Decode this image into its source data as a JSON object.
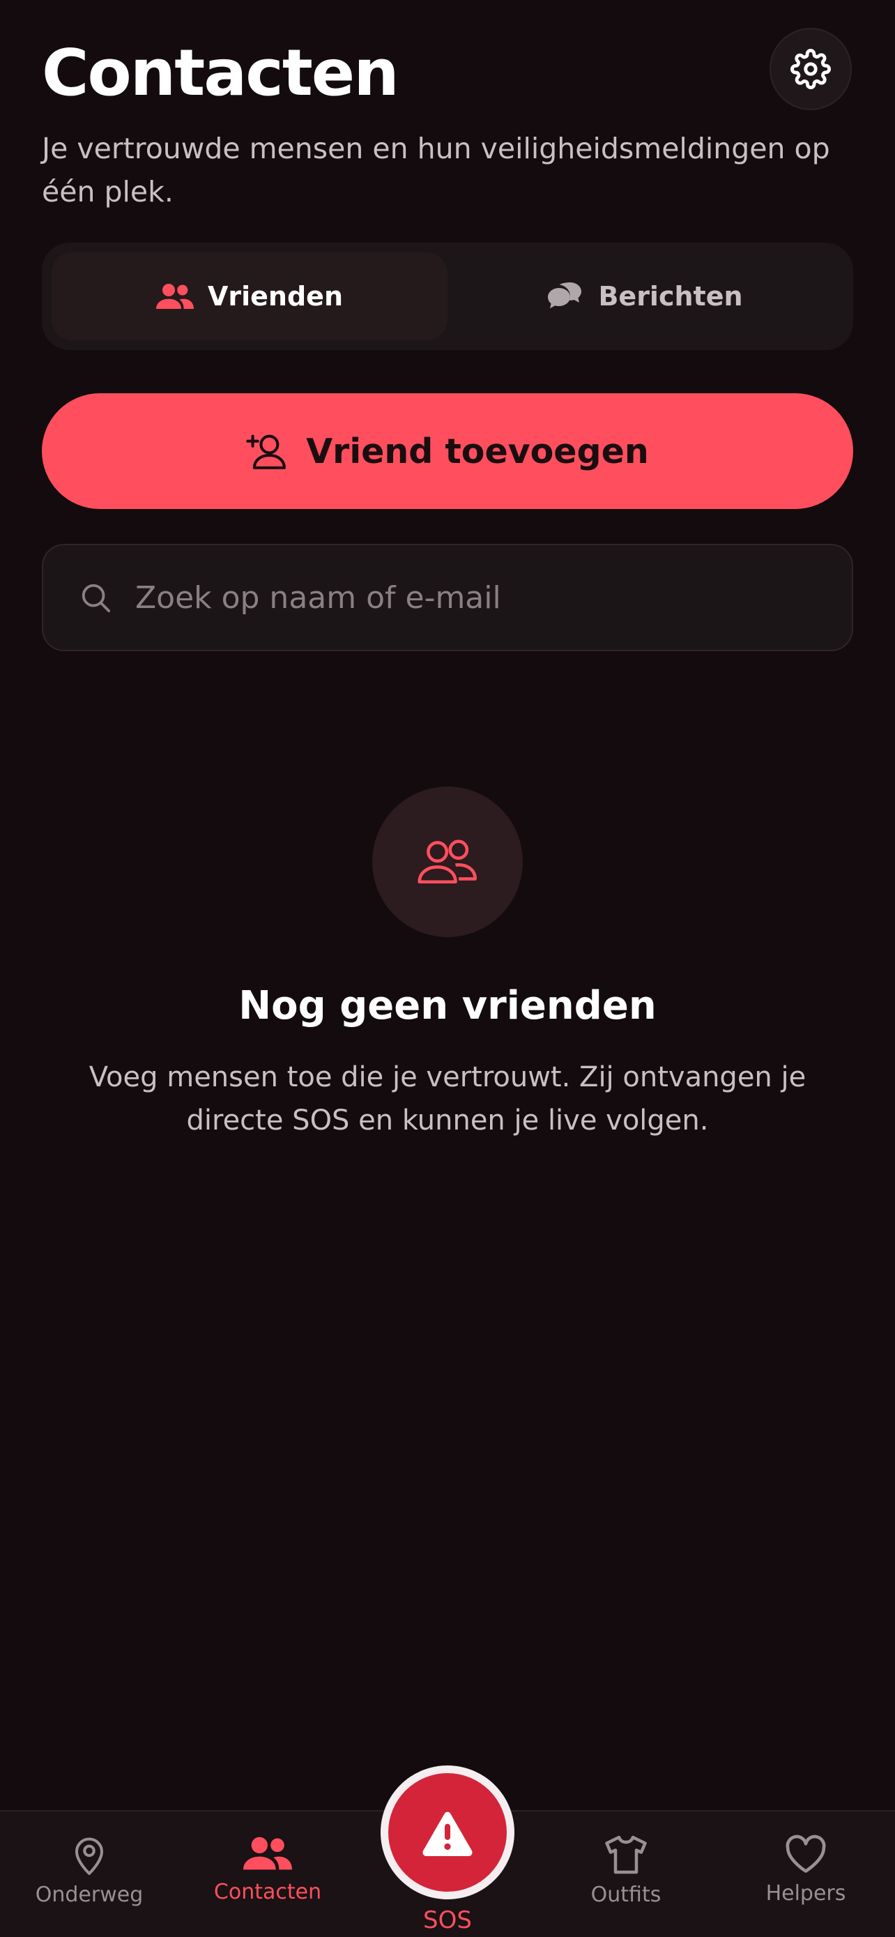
{
  "header": {
    "title": "Contacten",
    "subtitle": "Je vertrouwde mensen en hun veiligheidsmeldingen op één plek.",
    "settings_icon": "gear-icon"
  },
  "tabs": [
    {
      "label": "Vrienden",
      "icon": "users-icon",
      "active": true
    },
    {
      "label": "Berichten",
      "icon": "chat-bubbles-icon",
      "active": false
    }
  ],
  "add_friend": {
    "label": "Vriend toevoegen",
    "icon": "user-plus-icon"
  },
  "search": {
    "placeholder": "Zoek op naam of e-mail",
    "value": ""
  },
  "empty_state": {
    "icon": "users-icon",
    "title": "Nog geen vrienden",
    "text": "Voeg mensen toe die je vertrouwt. Zij ontvangen je directe SOS en kunnen je live volgen."
  },
  "bottom_nav": {
    "items": [
      {
        "label": "Onderweg",
        "icon": "map-pin-icon",
        "active": false
      },
      {
        "label": "Contacten",
        "icon": "users-icon",
        "active": true
      },
      {
        "label": "Outfits",
        "icon": "shirt-icon",
        "active": false
      },
      {
        "label": "Helpers",
        "icon": "heart-icon",
        "active": false
      }
    ],
    "sos": {
      "label": "SOS",
      "icon": "warning-icon"
    }
  },
  "colors": {
    "background": "#130b0d",
    "accent": "#ff4f5e",
    "sos": "#d3243a"
  }
}
